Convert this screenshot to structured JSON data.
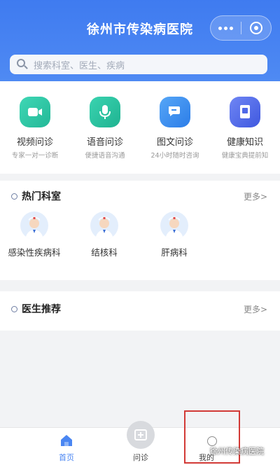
{
  "header": {
    "title": "徐州市传染病医院"
  },
  "search": {
    "placeholder": "搜索科室、医生、疾病"
  },
  "quick_actions": [
    {
      "label": "视频问诊",
      "subtitle": "专家一对一诊断",
      "icon": "video-icon",
      "color": "#2cc3a3"
    },
    {
      "label": "语音问诊",
      "subtitle": "便捷语音沟通",
      "icon": "microphone-icon",
      "color": "#27bfa0"
    },
    {
      "label": "图文问诊",
      "subtitle": "24小时随时咨询",
      "icon": "chat-bubble-icon",
      "color": "#3b8df0"
    },
    {
      "label": "健康知识",
      "subtitle": "健康宝典提前知",
      "icon": "book-icon",
      "color": "#4f69e8"
    }
  ],
  "hot_departments": {
    "title": "热门科室",
    "more": "更多>",
    "items": [
      {
        "label": "感染性疾病科"
      },
      {
        "label": "结核科"
      },
      {
        "label": "肝病科"
      }
    ]
  },
  "doctor_recommend": {
    "title": "医生推荐",
    "more": "更多>"
  },
  "tabbar": {
    "home": "首页",
    "consult": "问诊",
    "mine": "我的"
  },
  "watermark": "徐州传染病医院",
  "colors": {
    "brand_blue": "#4a86f2",
    "highlight_red": "#d23a36"
  }
}
